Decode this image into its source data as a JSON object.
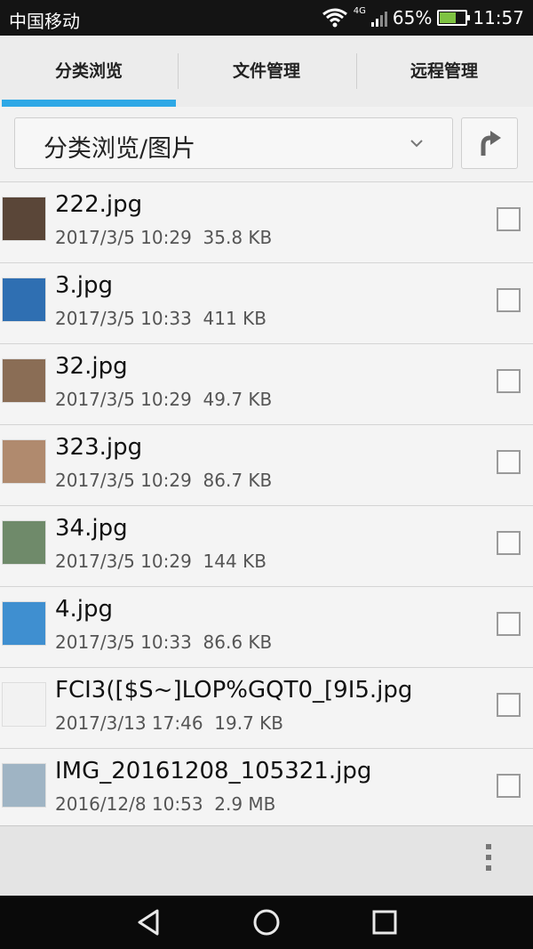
{
  "status_bar": {
    "carrier": "中国移动",
    "network": "4G",
    "battery_percent": "65%",
    "battery_level": 0.65,
    "time": "11:57",
    "icons": [
      "wifi-icon",
      "signal-icon",
      "battery-charging-icon"
    ]
  },
  "tabs": [
    {
      "label": "分类浏览",
      "active": true
    },
    {
      "label": "文件管理",
      "active": false
    },
    {
      "label": "远程管理",
      "active": false
    }
  ],
  "path_bar": {
    "path": "分类浏览/图片",
    "dropdown_icon": "chevron-down-icon",
    "up_icon": "arrow-up-icon"
  },
  "files": [
    {
      "name": "222.jpg",
      "date": "2017/3/5 10:29",
      "size": "35.8 KB",
      "thumb_color": "#5a4638"
    },
    {
      "name": "3.jpg",
      "date": "2017/3/5 10:33",
      "size": "411 KB",
      "thumb_color": "#2f6fb2"
    },
    {
      "name": "32.jpg",
      "date": "2017/3/5 10:29",
      "size": "49.7 KB",
      "thumb_color": "#8a6d55"
    },
    {
      "name": "323.jpg",
      "date": "2017/3/5 10:29",
      "size": "86.7 KB",
      "thumb_color": "#b08a6e"
    },
    {
      "name": "34.jpg",
      "date": "2017/3/5 10:29",
      "size": "144 KB",
      "thumb_color": "#6f8a6a"
    },
    {
      "name": "4.jpg",
      "date": "2017/3/5 10:33",
      "size": "86.6 KB",
      "thumb_color": "#3f8fd0"
    },
    {
      "name": "FCI3([$S~]LOP%GQT0_[9I5.jpg",
      "date": "2017/3/13 17:46",
      "size": "19.7 KB",
      "thumb_color": "#f2f2f2"
    },
    {
      "name": "IMG_20161208_105321.jpg",
      "date": "2016/12/8 10:53",
      "size": "2.9 MB",
      "thumb_color": "#9fb4c4"
    }
  ],
  "bottom_bar": {
    "menu_icon": "more-vertical-icon"
  },
  "nav_bar": {
    "icons": [
      "back-icon",
      "home-icon",
      "recents-icon"
    ]
  },
  "colors": {
    "accent": "#2ea8e6",
    "battery_fill": "#7ec242"
  }
}
